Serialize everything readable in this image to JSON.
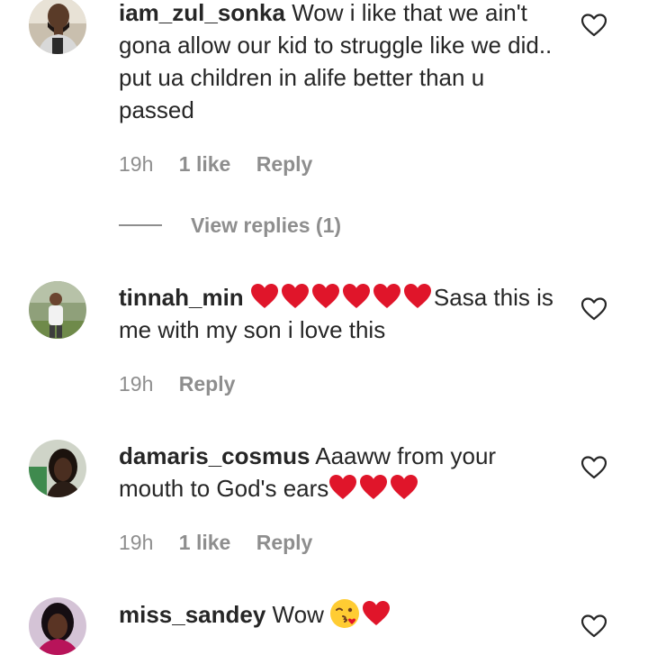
{
  "comments": [
    {
      "username": "iam_zul_sonka",
      "text_parts": [
        " Wow i like that we ain't gona allow our kid to struggle like we did.. put ua children in alife better than u passed"
      ],
      "time": "19h",
      "likes": "1 like",
      "reply_label": "Reply",
      "view_replies": "View replies (1)",
      "avatar_icon": "user-avatar-man-beard",
      "like_icon": "heart-outline-icon"
    },
    {
      "username": "tinnah_min",
      "heart_count": 6,
      "text_after": "Sasa this is me with my son i love this",
      "time": "19h",
      "reply_label": "Reply",
      "avatar_icon": "user-avatar-outdoor",
      "like_icon": "heart-outline-icon"
    },
    {
      "username": "damaris_cosmus",
      "text_before": " Aaaww from your mouth to God's ears",
      "heart_count": 3,
      "time": "19h",
      "likes": "1 like",
      "reply_label": "Reply",
      "avatar_icon": "user-avatar-woman",
      "like_icon": "heart-outline-icon"
    },
    {
      "username": "miss_sandey",
      "text_before": " Wow",
      "emoji": "face-blowing-kiss",
      "heart_count": 1,
      "avatar_icon": "user-avatar-woman-red",
      "like_icon": "heart-outline-icon"
    }
  ],
  "colors": {
    "text": "#262626",
    "meta": "#8e8e8e",
    "heart_red": "#e0152a",
    "background": "#ffffff"
  }
}
